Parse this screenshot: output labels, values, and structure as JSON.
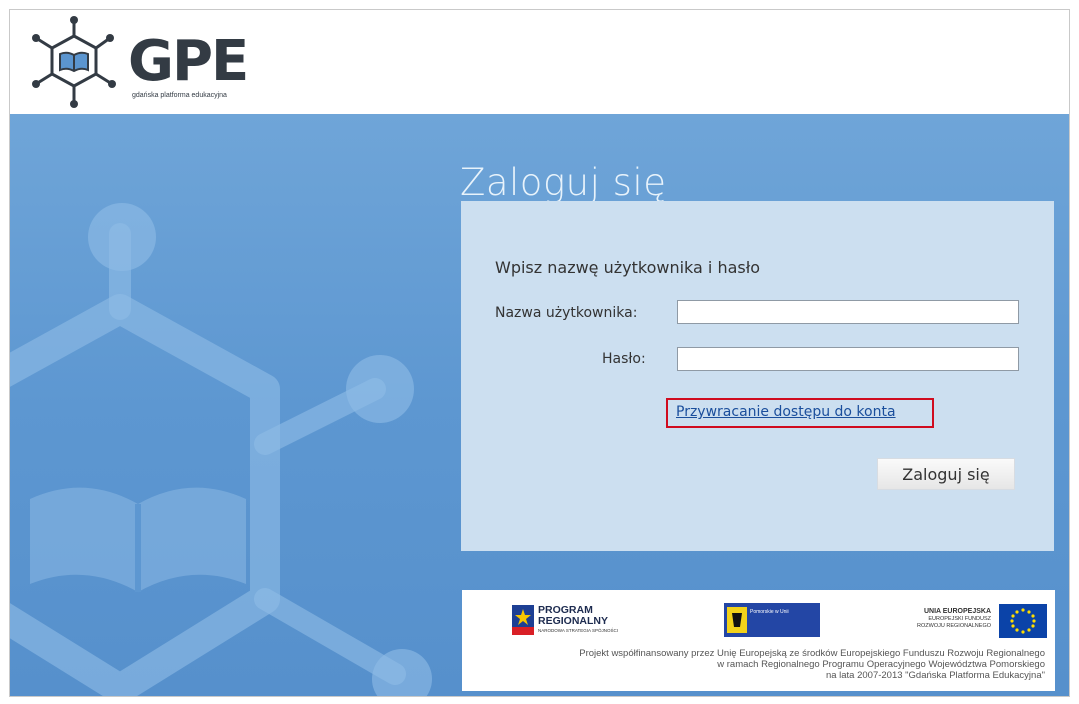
{
  "logo": {
    "name": "GPE",
    "tagline": "gdańska platforma edukacyjna"
  },
  "login": {
    "title": "Zaloguj się",
    "instructions": "Wpisz nazwę użytkownika i hasło",
    "username_label": "Nazwa użytkownika:",
    "username_value": "",
    "password_label": "Hasło:",
    "password_value": "",
    "recover_link": "Przywracanie dostępu do konta",
    "submit_label": "Zaloguj się"
  },
  "footer": {
    "program_logo_line1": "PROGRAM",
    "program_logo_line2": "REGIONALNY",
    "program_logo_sub": "NARODOWA STRATEGIA SPÓJNOŚCI",
    "pomorskie_logo_text": "Pomorskie w Unii",
    "eu_logo_line1": "UNIA EUROPEJSKA",
    "eu_logo_line2": "EUROPEJSKI FUNDUSZ",
    "eu_logo_line3": "ROZWOJU REGIONALNEGO",
    "text_line1": "Projekt współfinansowany przez Unię Europejską ze środków Europejskiego Funduszu Rozwoju Regionalnego",
    "text_line2": "w ramach Regionalnego Programu Operacyjnego Województwa Pomorskiego",
    "text_line3": "na lata 2007-2013 \"Gdańska Platforma Edukacyjna\""
  },
  "colors": {
    "background_blue": "#5d97d1",
    "panel": "#ccdff0",
    "highlight_red": "#d00c1f",
    "link_blue": "#1a4e9c",
    "logo_dark": "#333b44"
  }
}
